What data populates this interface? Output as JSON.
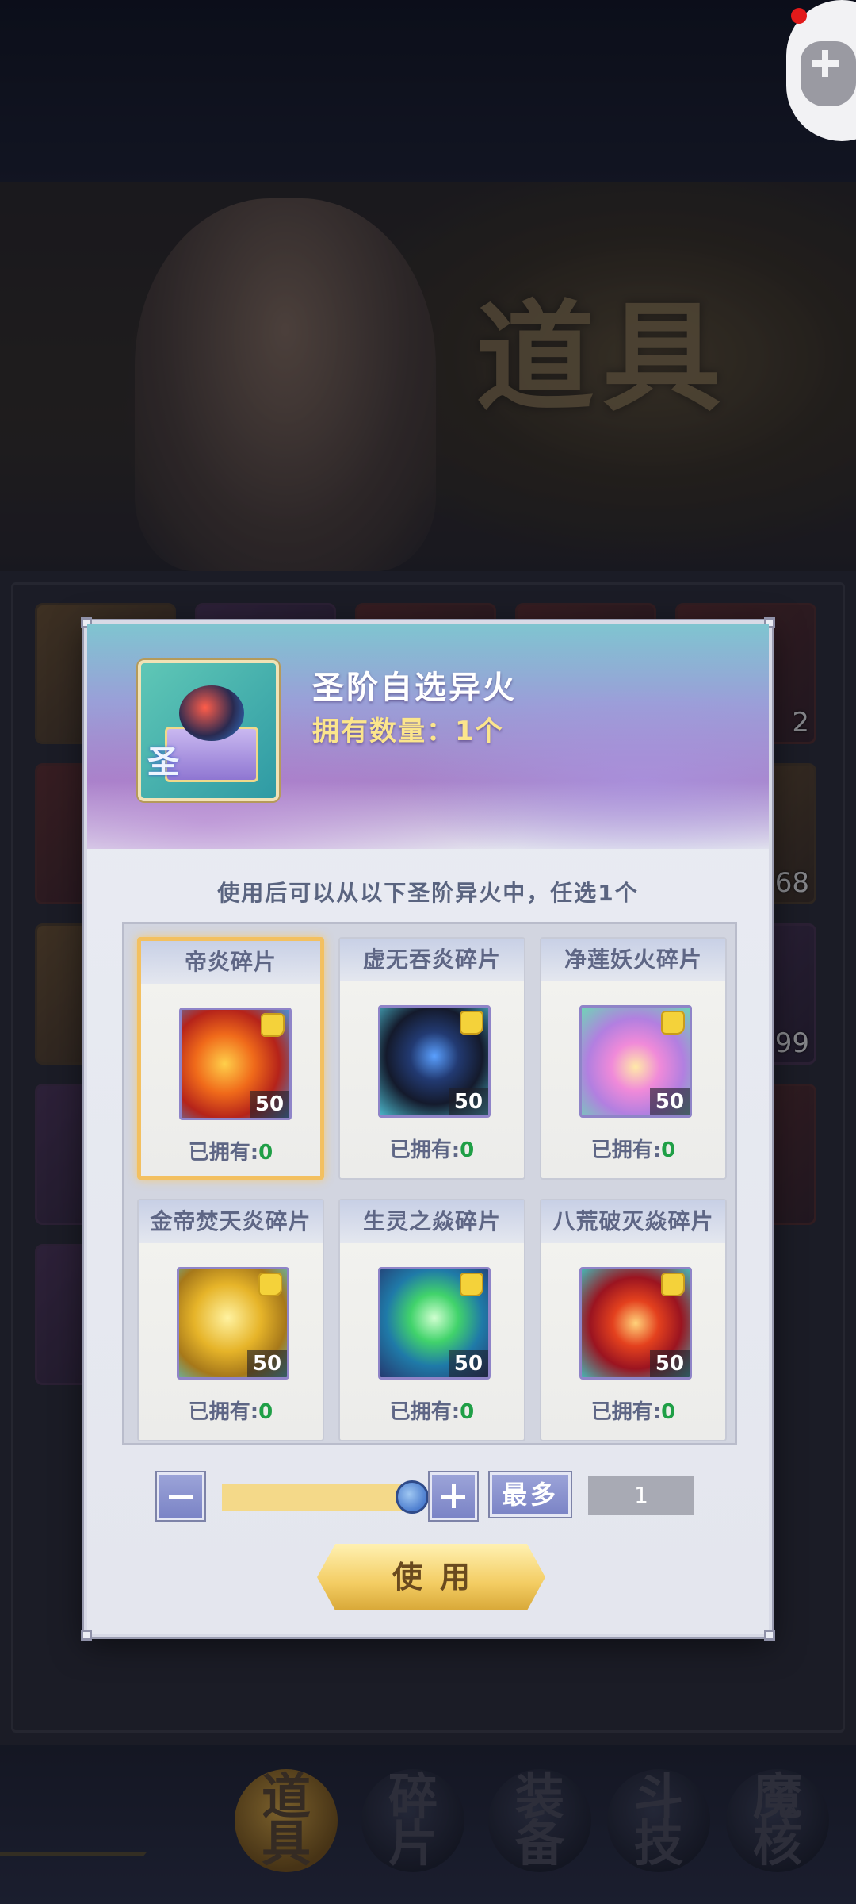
{
  "banner": {
    "title": "道具"
  },
  "inventory": {
    "counts": [
      "2",
      "68",
      "99"
    ]
  },
  "modal": {
    "item_name": "圣阶自选异火",
    "owned_label": "拥有数量：1个",
    "instruction": "使用后可以从以下圣阶异火中，任选1个",
    "choices": [
      {
        "title": "帝炎碎片",
        "qty": "50",
        "owned_label": "已拥有:",
        "owned_value": "0",
        "art": "flame-dragon-red"
      },
      {
        "title": "虚无吞炎碎片",
        "qty": "50",
        "owned_label": "已拥有:",
        "owned_value": "0",
        "art": "hooded-figure-blue"
      },
      {
        "title": "净莲妖火碎片",
        "qty": "50",
        "owned_label": "已拥有:",
        "owned_value": "0",
        "art": "lotus-flame-pink"
      },
      {
        "title": "金帝焚天炎碎片",
        "qty": "50",
        "owned_label": "已拥有:",
        "owned_value": "0",
        "art": "dragon-gold"
      },
      {
        "title": "生灵之焱碎片",
        "qty": "50",
        "owned_label": "已拥有:",
        "owned_value": "0",
        "art": "flame-green"
      },
      {
        "title": "八荒破灭焱碎片",
        "qty": "50",
        "owned_label": "已拥有:",
        "owned_value": "0",
        "art": "flame-crimson"
      }
    ],
    "selected_index": 0,
    "quantity": {
      "max_label": "最多",
      "value": "1",
      "slider_fraction": 1.0
    },
    "use_label": "使用"
  },
  "bottom_nav": {
    "tabs": [
      {
        "label": "道具",
        "active": true
      },
      {
        "label": "碎片",
        "active": false
      },
      {
        "label": "装备",
        "active": false
      },
      {
        "label": "斗技",
        "active": false
      },
      {
        "label": "魔核",
        "active": false
      }
    ]
  },
  "icons": {
    "float": "gamepad-icon",
    "chest": "treasure-chest-icon",
    "fragment": "puzzle-piece-icon"
  },
  "colors": {
    "accent_gold": "#f3c060",
    "owned_green": "#1f9f46",
    "button_blue": "#7b84c6"
  }
}
